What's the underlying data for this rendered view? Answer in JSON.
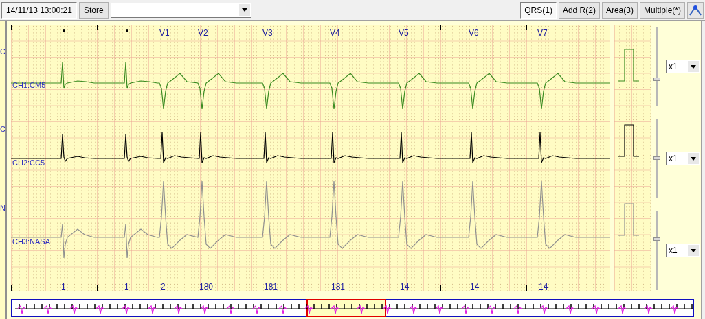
{
  "toolbar": {
    "timestamp": "14/11/13 13:00:21",
    "store_button": {
      "key": "S",
      "post": "tore"
    },
    "tool_buttons": [
      {
        "pre": "QRS(",
        "key": "1",
        "post": ")",
        "selected": true
      },
      {
        "pre": "Add R(",
        "key": "2",
        "post": ")",
        "selected": false
      },
      {
        "pre": "Area(",
        "key": "3",
        "post": ")",
        "selected": false
      },
      {
        "pre": "Multiple(",
        "key": "*",
        "post": ")",
        "selected": false
      }
    ]
  },
  "left_edge_labels": [
    "C",
    "C",
    "N"
  ],
  "channels": [
    {
      "label": "CH1:CM5",
      "color": "#3a8a20",
      "gain": "x1",
      "level": 0.33
    },
    {
      "label": "CH2:CC5",
      "color": "#000000",
      "gain": "x1",
      "level": 0.5
    },
    {
      "label": "CH3:NASA",
      "color": "#909090",
      "gain": "x1",
      "level": 0.64
    }
  ],
  "beats": [
    {
      "kind": "dot",
      "label": "1"
    },
    {
      "kind": "dot",
      "label": "1"
    },
    {
      "kind": "lead",
      "lead": "V1",
      "label": "2"
    },
    {
      "kind": "lead",
      "lead": "V2",
      "label": "180"
    },
    {
      "kind": "lead",
      "lead": "V3",
      "label": "181"
    },
    {
      "kind": "lead",
      "lead": "V4",
      "label": "181"
    },
    {
      "kind": "lead",
      "lead": "V5",
      "label": "14"
    },
    {
      "kind": "lead",
      "lead": "V6",
      "label": "14"
    },
    {
      "kind": "lead",
      "lead": "V7",
      "label": "14"
    }
  ]
}
